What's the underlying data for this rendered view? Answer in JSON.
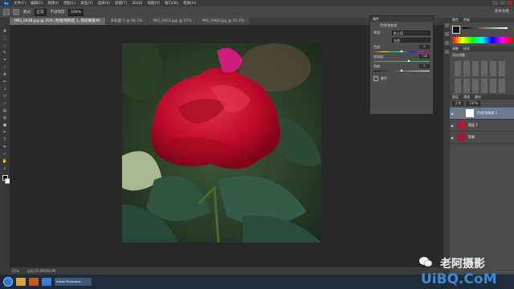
{
  "app": {
    "logo": "Ps",
    "workspace": "基本功能"
  },
  "menu": [
    "文件(F)",
    "编辑(E)",
    "图像(I)",
    "图层(L)",
    "类型(Y)",
    "选择(S)",
    "滤镜(T)",
    "3D(D)",
    "视图(V)",
    "窗口(W)",
    "帮助(H)"
  ],
  "options": {
    "mode_label": "模式:",
    "mode_value": "正常",
    "opacity_label": "不透明度:",
    "opacity_value": "100%"
  },
  "tabs": [
    {
      "label": "IMG_0438.jpg @ 25% (色相/饱和度 1, 图层蒙版/8)",
      "active": true
    },
    {
      "label": "未标题-1 @ 66.7%",
      "active": false
    },
    {
      "label": "IMG_0451.jpg @ 25%",
      "active": false
    },
    {
      "label": "IMG_0466.jpg @ 33.3%",
      "active": false
    }
  ],
  "status": {
    "zoom": "25%",
    "doc": "文档:15.0M/30.0M"
  },
  "properties": {
    "title": "属性",
    "adjustment": "色相/饱和度",
    "preset_label": "预设:",
    "preset_value": "默认值",
    "channel_label": "全图",
    "hue_label": "色相:",
    "hue_value": "0",
    "sat_label": "饱和度:",
    "sat_value": "+26",
    "light_label": "明度:",
    "light_value": "0",
    "colorize_label": "着色",
    "hue_pos": 0.5,
    "sat_pos": 0.63,
    "light_pos": 0.5
  },
  "panels": {
    "color_tabs": [
      "颜色",
      "色板"
    ],
    "adjust_tabs": [
      "调整",
      "样式"
    ],
    "adjust_title": "添加调整",
    "layers_tabs": [
      "图层",
      "通道",
      "路径"
    ],
    "blend": "正常",
    "opacity": "100%",
    "layers": [
      {
        "name": "色相/饱和度 1",
        "type": "adjustment",
        "selected": true
      },
      {
        "name": "图层 1",
        "type": "image",
        "selected": false
      },
      {
        "name": "背景",
        "type": "image",
        "selected": false
      }
    ]
  },
  "taskbar": {
    "active_label": "Adobe Photoshop"
  },
  "watermark": {
    "cn": "老阿摄影",
    "en": "UiBQ.CoM"
  },
  "colors": {
    "accent": "#3b8ad8",
    "rose": "#c8102e",
    "panel": "#4b4b4b"
  }
}
